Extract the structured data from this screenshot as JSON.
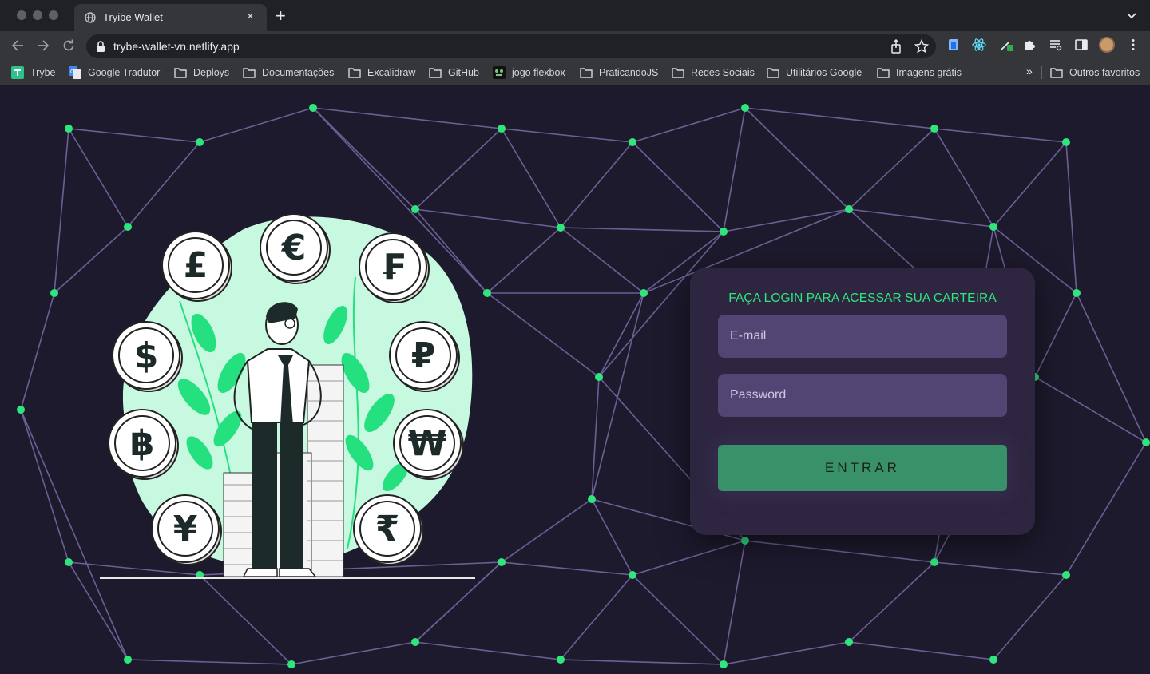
{
  "browser": {
    "tab_title": "Tryibe Wallet",
    "url": "trybe-wallet-vn.netlify.app",
    "new_tab_label": "+",
    "close_label": "×"
  },
  "bookmarks": {
    "items": [
      {
        "label": "Trybe",
        "icon": "trybe-icon"
      },
      {
        "label": "Google Tradutor",
        "icon": "google-translate-icon"
      },
      {
        "label": "Deploys",
        "icon": "folder-icon"
      },
      {
        "label": "Documentações",
        "icon": "folder-icon"
      },
      {
        "label": "Excalidraw",
        "icon": "folder-icon"
      },
      {
        "label": "GitHub",
        "icon": "folder-icon"
      },
      {
        "label": "jogo flexbox",
        "icon": "frog-icon"
      },
      {
        "label": "PraticandoJS",
        "icon": "folder-icon"
      },
      {
        "label": "Redes Sociais",
        "icon": "folder-icon"
      },
      {
        "label": "Utilitários Google",
        "icon": "folder-icon"
      },
      {
        "label": "Imagens grátis",
        "icon": "folder-icon"
      }
    ],
    "more_label": "»",
    "other_favorites": "Outros favoritos"
  },
  "login": {
    "title": "FAÇA LOGIN PARA ACESSAR SUA CARTEIRA",
    "email_placeholder": "E-mail",
    "password_placeholder": "Password",
    "submit_label": "ENTRAR"
  },
  "illustration": {
    "coins": [
      "£",
      "€",
      "₣",
      "$",
      "₽",
      "฿",
      "₩",
      "¥",
      "₹"
    ]
  },
  "colors": {
    "page_bg": "#1e1a2e",
    "accent_green": "#2fe67d",
    "card_bg": "#2e2640",
    "input_bg": "#534573",
    "button_bg": "#39916a"
  }
}
